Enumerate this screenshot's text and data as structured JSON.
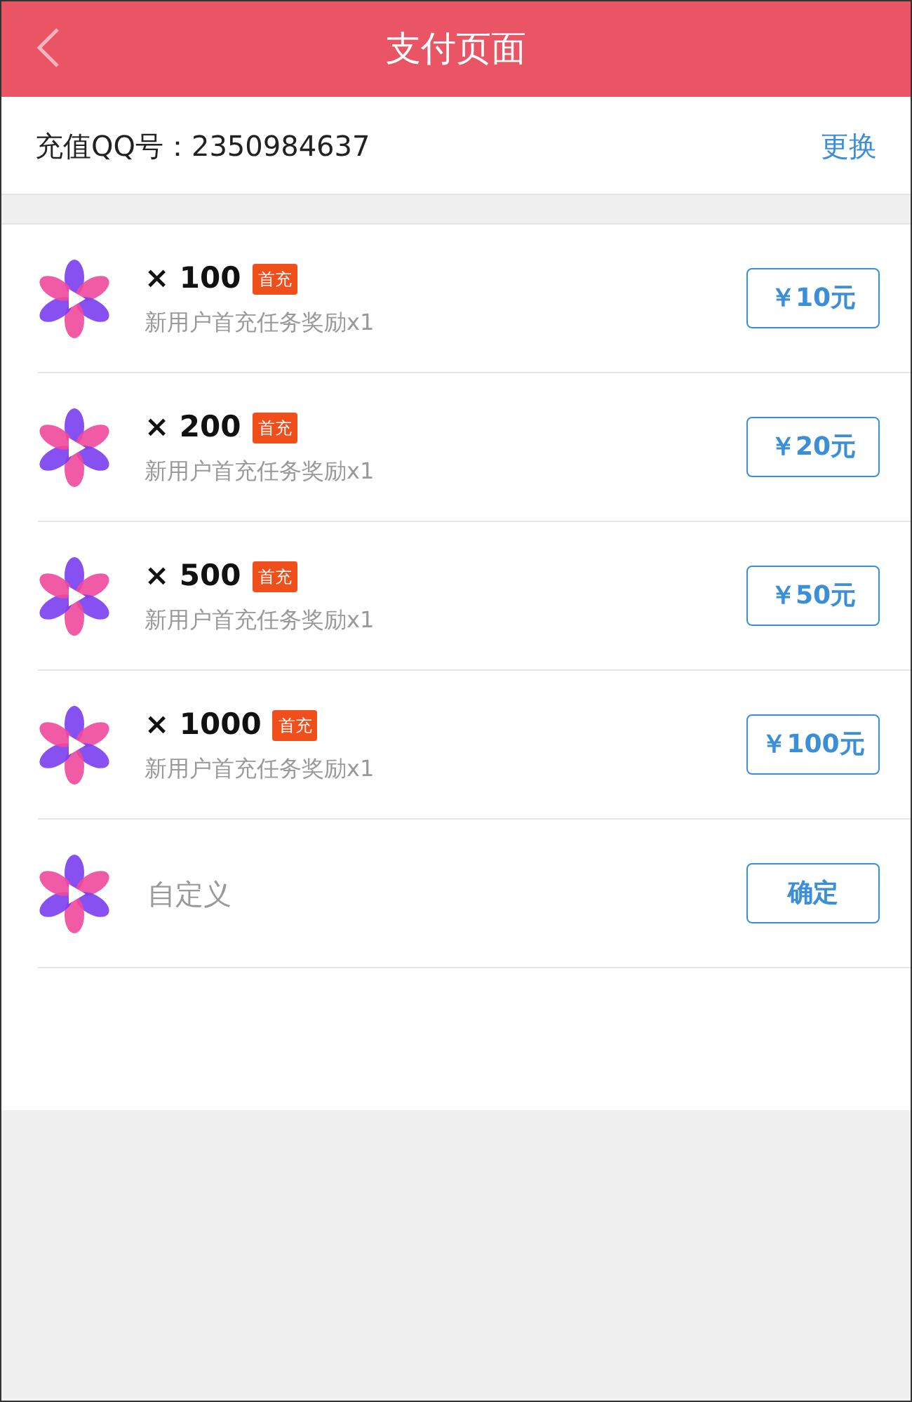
{
  "header": {
    "title": "支付页面"
  },
  "account": {
    "label": "充值QQ号：2350984637",
    "action": "更换"
  },
  "items": [
    {
      "kind": "preset",
      "amount": "× 100",
      "badge": "首充",
      "note": "新用户首充任务奖励x1",
      "button": "￥10元"
    },
    {
      "kind": "preset",
      "amount": "× 200",
      "badge": "首充",
      "note": "新用户首充任务奖励x1",
      "button": "￥20元"
    },
    {
      "kind": "preset",
      "amount": "× 500",
      "badge": "首充",
      "note": "新用户首充任务奖励x1",
      "button": "￥50元"
    },
    {
      "kind": "preset",
      "amount": "× 1000",
      "badge": "首充",
      "note": "新用户首充任务奖励x1",
      "button": "￥100元"
    },
    {
      "kind": "custom",
      "placeholder": "自定义",
      "button": "确定"
    }
  ]
}
